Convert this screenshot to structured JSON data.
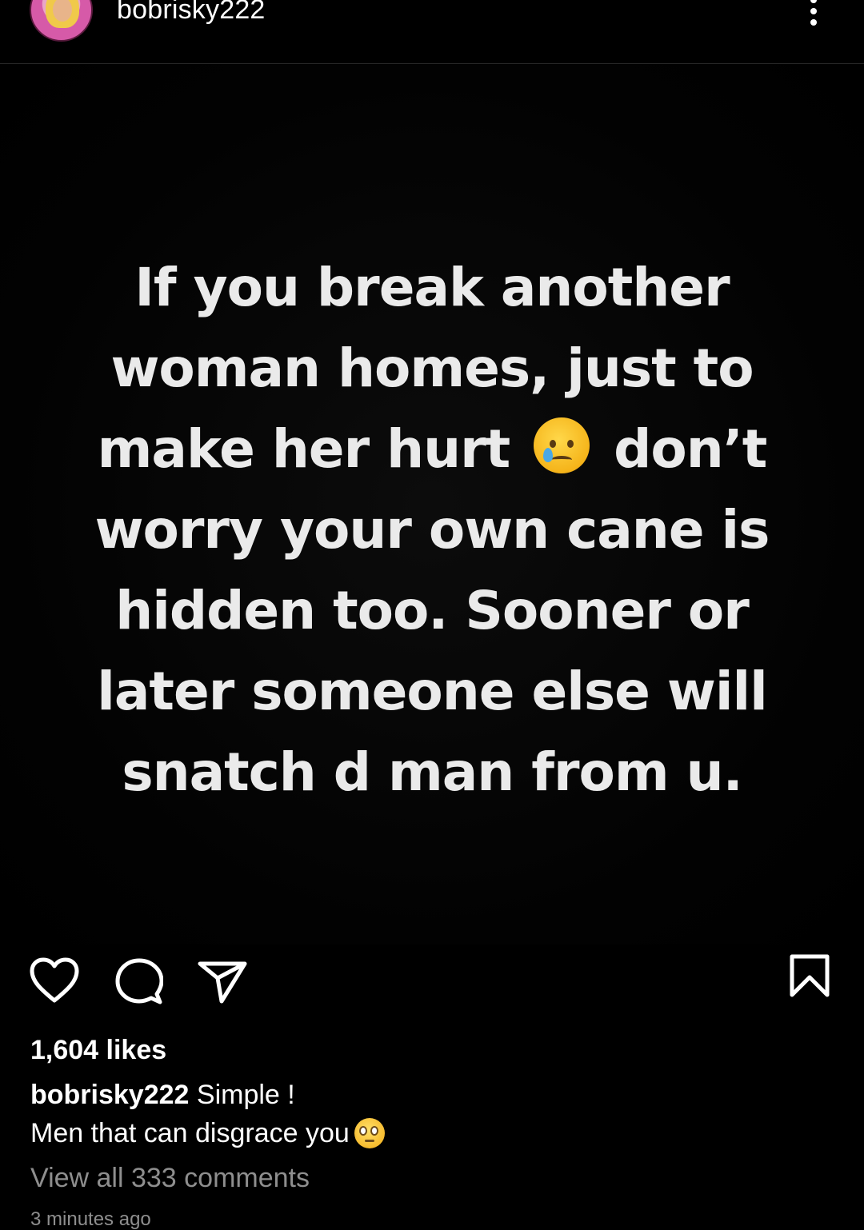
{
  "header": {
    "username": "bobrisky222",
    "avatar_icon": "profile-avatar",
    "more_icon": "more-vertical-icon"
  },
  "post": {
    "quote_lines": [
      "If you break another",
      "woman homes, just to",
      "make her hurt",
      "don’t",
      "worry your own cane is",
      "hidden too. Sooner or",
      "later someone else will",
      "snatch d man from u."
    ],
    "emoji": "crying-face-emoji"
  },
  "actions": {
    "like_icon": "heart-icon",
    "comment_icon": "comment-icon",
    "share_icon": "send-icon",
    "save_icon": "bookmark-icon"
  },
  "meta": {
    "likes": "1,604 likes",
    "caption_user": "bobrisky222",
    "caption_line1": "Simple !",
    "caption_line2": "Men that can disgrace you",
    "caption_emoji": "eye-roll-emoji",
    "view_comments": "View all 333 comments",
    "timestamp": "3 minutes ago"
  },
  "colors": {
    "background": "#000000",
    "text": "#ffffff",
    "muted": "#8e8e8e",
    "quote_text": "#eaeaea"
  }
}
